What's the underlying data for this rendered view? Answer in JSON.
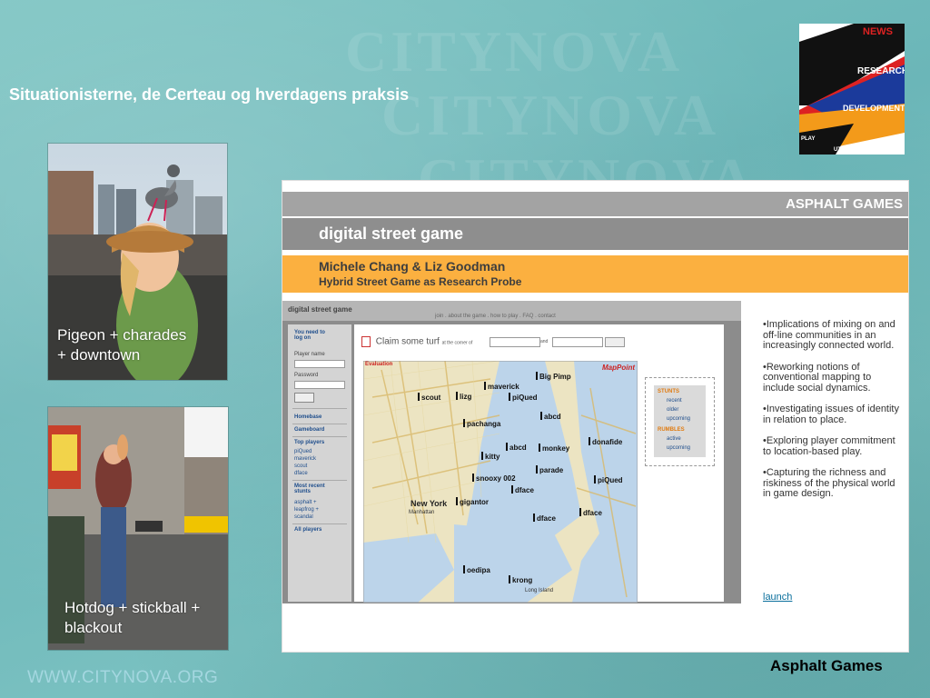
{
  "slide": {
    "title": "Situationisterne, de Certeau og hverdagens praksis",
    "footer_url": "WWW.CITYNOVA.ORG",
    "caption_right": "Asphalt Games",
    "photos": [
      {
        "caption_line1": "Pigeon + charades",
        "caption_line2": "+ downtown"
      },
      {
        "caption_line1": "Hotdog + stickball +",
        "caption_line2": "blackout"
      }
    ],
    "logo": {
      "label_news": "NEWS",
      "label_research": "RESEARCH",
      "label_development": "DEVELOPMENT",
      "label_play": "PLAY",
      "label_utopia": "UTOPIA"
    }
  },
  "website": {
    "brand": "ASPHALT GAMES",
    "section_title": "digital street game",
    "authors": "Michele Chang & Liz Goodman",
    "subtitle": "Hybrid Street Game as Research Probe",
    "game": {
      "logo": "digital street game",
      "nav": "join . about the game . how to play . FAQ . contact",
      "sidebar": {
        "login_prompt_1": "You need to",
        "login_prompt_2": "log on",
        "player_name_label": "Player name",
        "password_label": "Password",
        "homebase": "Homebase",
        "gameboard": "Gameboard",
        "top_players_label": "Top players",
        "top_players": [
          "piQued",
          "maverick",
          "scout",
          "dface"
        ],
        "recent_stunts_1": "Most recent",
        "recent_stunts_2": "stunts",
        "recent_stunts": [
          "asphalt +",
          "leapfrog +",
          "scandal"
        ],
        "all_players": "All players"
      },
      "claim": {
        "text": "Claim some turf",
        "corner_label": "at the corner of",
        "and_label": "and"
      },
      "map": {
        "evaluation_label": "Evaluation",
        "provider": "MapPoint",
        "labels": {
          "new_york": "New York",
          "manhattan": "Manhattan",
          "long_island": "Long Island"
        },
        "players": [
          "Big Pimp",
          "maverick",
          "scout",
          "lizg",
          "piQued",
          "pachanga",
          "abcd",
          "abcd",
          "monkey",
          "donafide",
          "kitty",
          "parade",
          "snooxy 002",
          "dface",
          "gigantor",
          "piQued",
          "dface",
          "dface",
          "oedipa",
          "krong"
        ]
      },
      "legend": {
        "stunts_label": "STUNTS",
        "recent": "recent",
        "older": "older",
        "upcoming": "upcoming",
        "rumbles_label": "RUMBLES",
        "active": "active",
        "upcoming_rumbles": "upcoming"
      }
    },
    "bullets": [
      "•Implications of mixing on and off-line communities in an increasingly connected world.",
      "•Reworking notions of conventional mapping to include social dynamics.",
      "•Investigating issues of identity in relation to place.",
      "•Exploring player commitment to location-based play.",
      "•Capturing the richness and riskiness of the physical world in game design."
    ],
    "launch": "launch"
  }
}
